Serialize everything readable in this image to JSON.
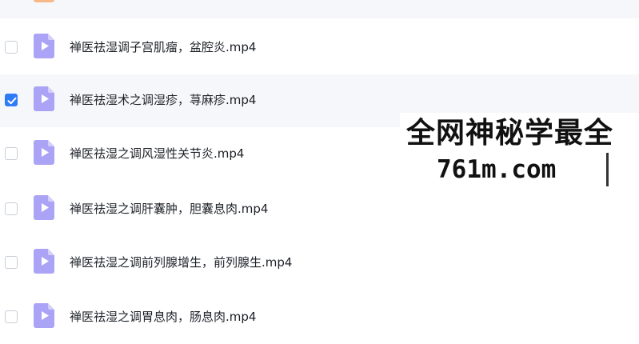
{
  "file_list": {
    "partial_row": {
      "icon": "folder-icon",
      "icon_color": "#f8b98a"
    },
    "rows": [
      {
        "name": "禅医祛湿调子宫肌瘤，盆腔炎.mp4",
        "checked": false,
        "icon": "video-file-icon"
      },
      {
        "name": "禅医祛湿术之调湿疹，荨麻疹.mp4",
        "checked": true,
        "icon": "video-file-icon"
      },
      {
        "name": "禅医祛湿之调风湿性关节炎.mp4",
        "checked": false,
        "icon": "video-file-icon"
      },
      {
        "name": "禅医祛湿之调肝囊肿，胆囊息肉.mp4",
        "checked": false,
        "icon": "video-file-icon"
      },
      {
        "name": "禅医祛湿之调前列腺增生，前列腺生.mp4",
        "checked": false,
        "icon": "video-file-icon"
      },
      {
        "name": "禅医祛湿之调胃息肉，肠息肉.mp4",
        "checked": false,
        "icon": "video-file-icon"
      }
    ]
  },
  "watermark": {
    "line1": "全网神秘学最全",
    "line2": "761m.com"
  },
  "colors": {
    "checkbox_checked": "#2f7bf5",
    "video_icon_body": "#aba3f5",
    "video_icon_fold": "#d4cffa",
    "row_alt_bg": "#f6f7fa"
  }
}
